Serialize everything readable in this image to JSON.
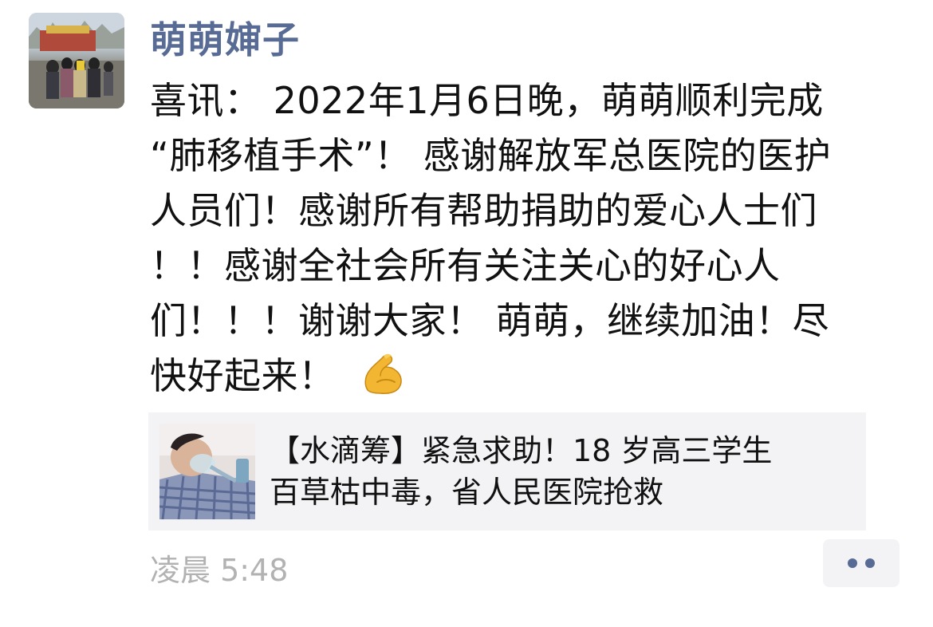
{
  "post": {
    "author": "萌萌婶子",
    "content_lines": [
      "喜讯： 2022年1月6日晚，萌萌顺利完成",
      "“肺移植手术”！ 感谢解放军总医院的医护",
      "人员们！感谢所有帮助捐助的爱心人士们",
      "！！感谢全社会所有关注关心的好心人",
      "们！！！谢谢大家！ 萌萌，继续加油！尽",
      "快好起来！"
    ],
    "content_emoji": "flexed-biceps-emoji",
    "link": {
      "title_lines": [
        "【水滴筹】紧急求助！18 岁高三学生",
        "百草枯中毒，省人民医院抢救"
      ]
    },
    "timestamp": "凌晨 5:48"
  },
  "colors": {
    "author_name": "#576b95",
    "body_text": "#111111",
    "timestamp": "#b2b2b2",
    "card_background": "#f3f3f5"
  },
  "icons": {
    "more_actions": "more-dots-icon"
  }
}
